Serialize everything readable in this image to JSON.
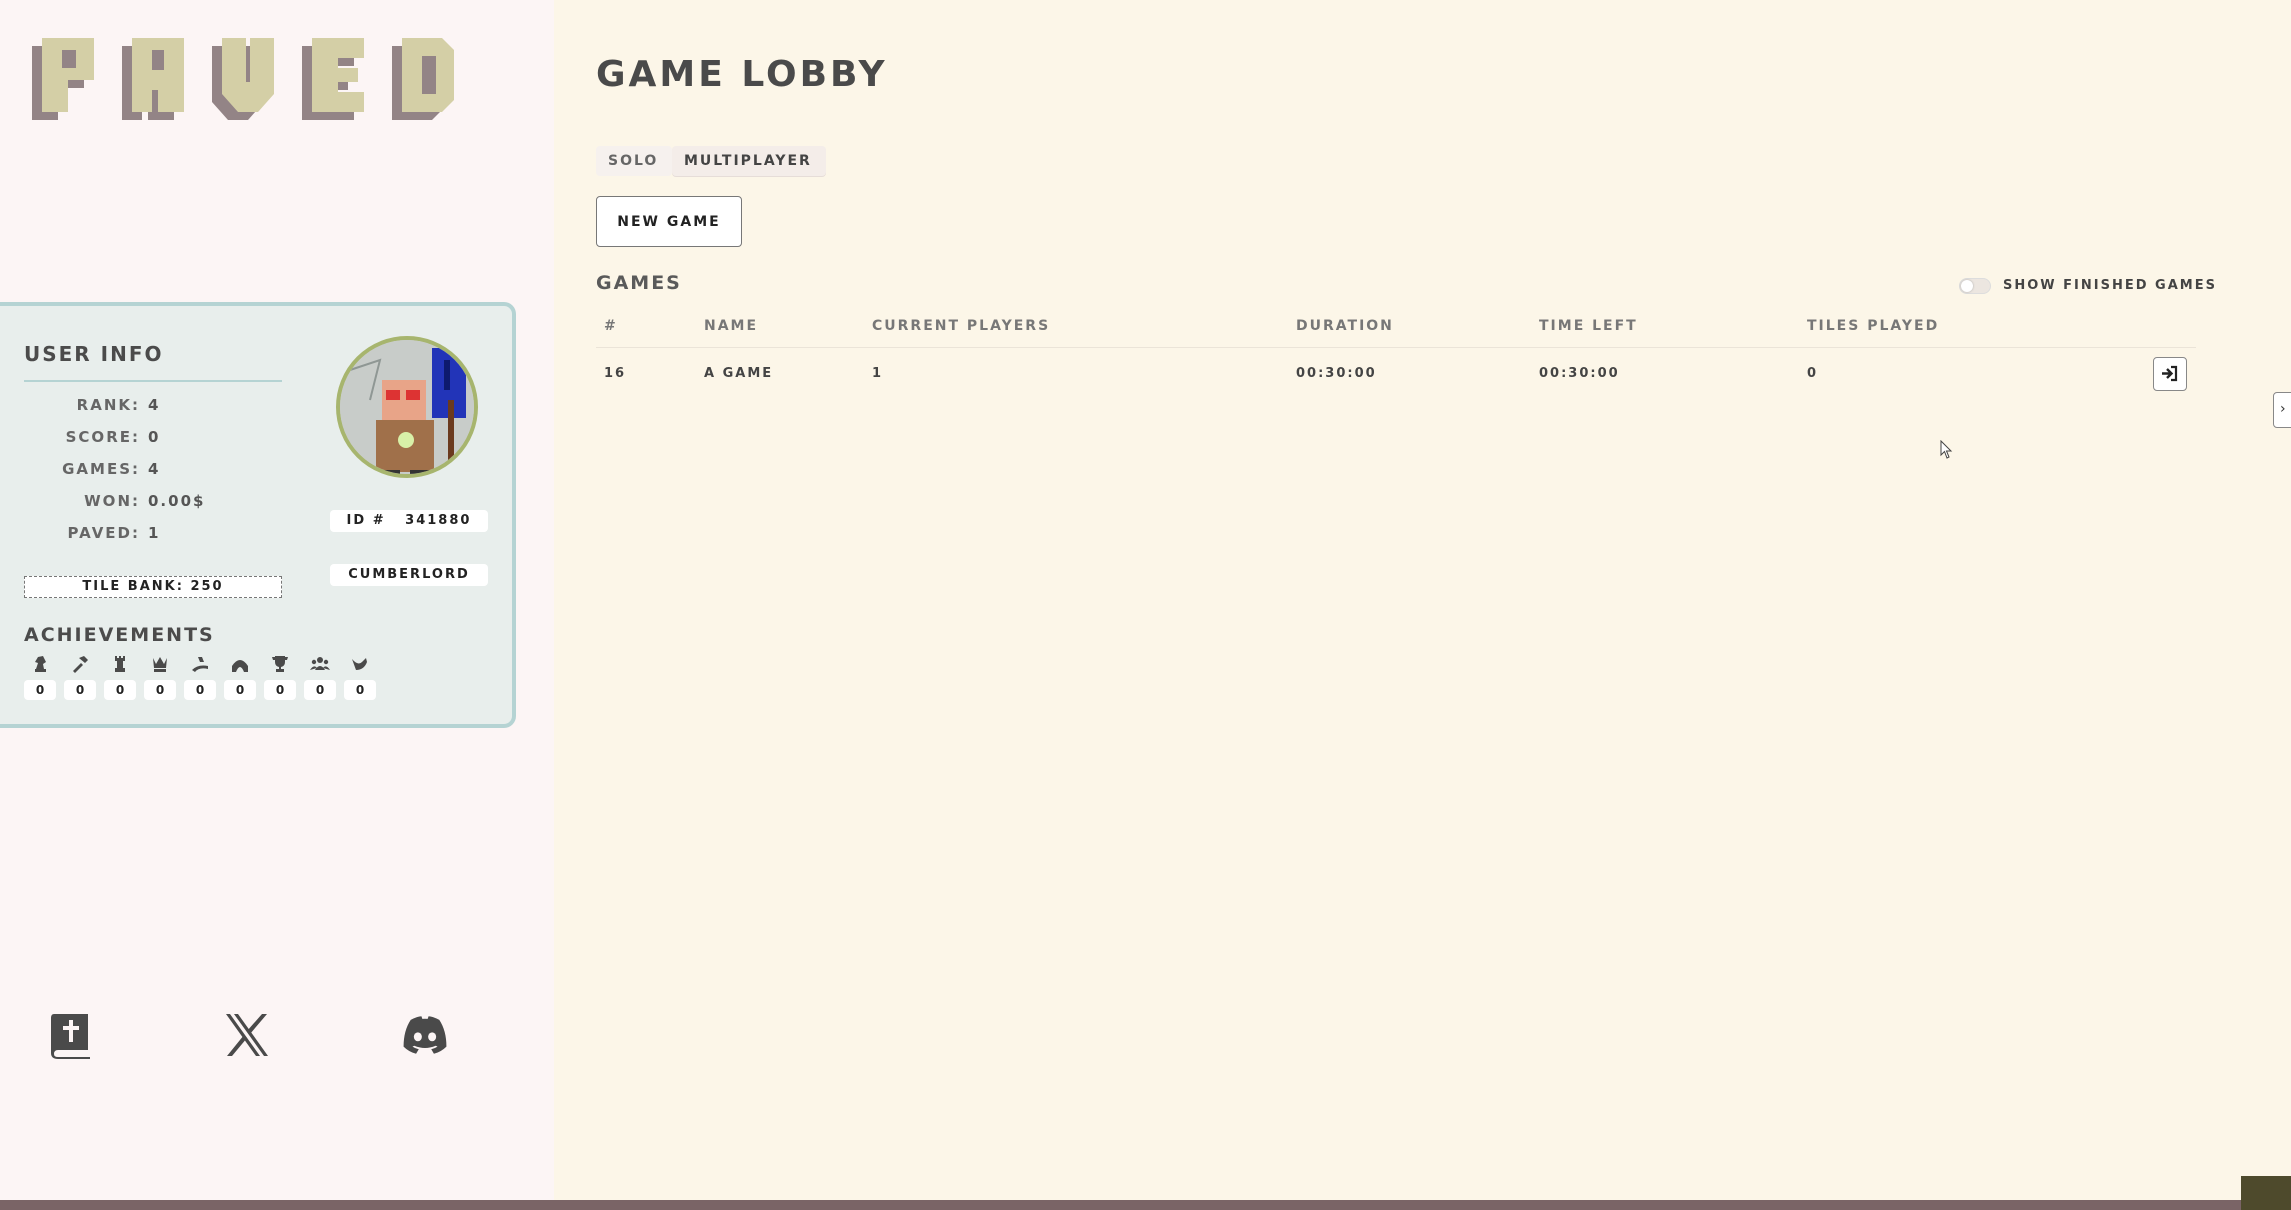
{
  "app": {
    "logo_text": "PAVED"
  },
  "user_info": {
    "title": "USER INFO",
    "stats": [
      {
        "label": "RANK",
        "value": "4"
      },
      {
        "label": "SCORE",
        "value": "0"
      },
      {
        "label": "GAMES",
        "value": "4"
      },
      {
        "label": "WON",
        "value": "0.00$"
      },
      {
        "label": "PAVED",
        "value": "1"
      }
    ],
    "tile_bank": "TILE BANK: 250",
    "id_badge": "ID #   341880",
    "username": "CUMBERLORD"
  },
  "achievements": {
    "title": "ACHIEVEMENTS",
    "items": [
      {
        "icon": "chess-knight-icon",
        "count": "0"
      },
      {
        "icon": "hammer-icon",
        "count": "0"
      },
      {
        "icon": "chess-rook-icon",
        "count": "0"
      },
      {
        "icon": "chess-queen-icon",
        "count": "0"
      },
      {
        "icon": "road-icon",
        "count": "0"
      },
      {
        "icon": "bridge-icon",
        "count": "0"
      },
      {
        "icon": "trophy-icon",
        "count": "0"
      },
      {
        "icon": "users-icon",
        "count": "0"
      },
      {
        "icon": "bird-icon",
        "count": "0"
      }
    ]
  },
  "social": [
    "book-icon",
    "x-icon",
    "discord-icon"
  ],
  "main": {
    "title": "GAME LOBBY",
    "tabs": [
      "SOLO",
      "MULTIPLAYER"
    ],
    "active_tab": "MULTIPLAYER",
    "new_game_label": "NEW GAME",
    "games_heading": "GAMES",
    "show_finished_label": "SHOW FINISHED GAMES",
    "show_finished_on": false,
    "columns": [
      "#",
      "NAME",
      "CURRENT PLAYERS",
      "DURATION",
      "TIME LEFT",
      "TILES PLAYED"
    ],
    "rows": [
      {
        "id": "16",
        "name": "A GAME",
        "players": "1",
        "duration": "00:30:00",
        "time_left": "00:30:00",
        "tiles_played": "0"
      }
    ]
  },
  "colors": {
    "sidebar_bg": "#fcf5f5",
    "main_bg": "#fcf6e8",
    "card_bg": "#e8eeec",
    "card_border": "#b5d3d3",
    "logo_face": "#d4cfa6",
    "logo_shadow": "#938486"
  }
}
